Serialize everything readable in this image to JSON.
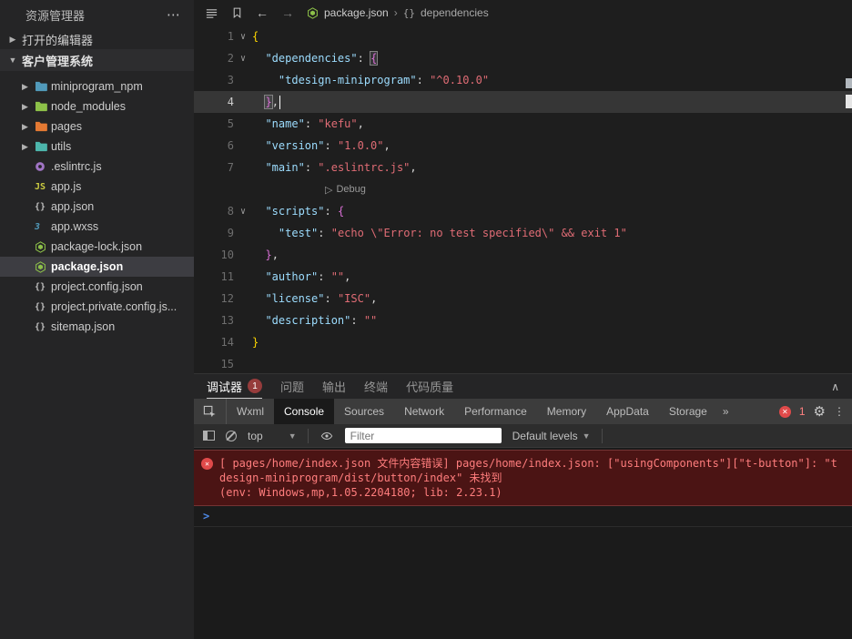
{
  "explorer": {
    "title": "资源管理器",
    "more": "⋯",
    "open_editors_label": "打开的编辑器",
    "project_label": "客户管理系统",
    "files": [
      {
        "name": "miniprogram_npm",
        "icon": "folder",
        "color": "#519aba"
      },
      {
        "name": "node_modules",
        "icon": "folder",
        "color": "#8dc149"
      },
      {
        "name": "pages",
        "icon": "folder",
        "color": "#e37933"
      },
      {
        "name": "utils",
        "icon": "folder",
        "color": "#4db6ac"
      },
      {
        "name": ".eslintrc.js",
        "icon": "eslint",
        "color": "#a074c4"
      },
      {
        "name": "app.js",
        "icon": "js",
        "color": "#cbcb41"
      },
      {
        "name": "app.json",
        "icon": "json",
        "color": "#bdbdbd"
      },
      {
        "name": "app.wxss",
        "icon": "wxss",
        "color": "#519aba"
      },
      {
        "name": "package-lock.json",
        "icon": "npm",
        "color": "#8dc149"
      },
      {
        "name": "package.json",
        "icon": "npm",
        "color": "#8dc149",
        "selected": true
      },
      {
        "name": "project.config.json",
        "icon": "json",
        "color": "#bdbdbd"
      },
      {
        "name": "project.private.config.js...",
        "icon": "json",
        "color": "#bdbdbd"
      },
      {
        "name": "sitemap.json",
        "icon": "json",
        "color": "#bdbdbd"
      }
    ]
  },
  "topbar": {
    "breadcrumb_file": "package.json",
    "breadcrumb_separator": "›",
    "breadcrumb_symbol_icon": "{}",
    "breadcrumb_symbol": "dependencies"
  },
  "editor": {
    "lines": [
      {
        "num": "1",
        "fold": true,
        "segs": [
          [
            "b1",
            "{"
          ]
        ]
      },
      {
        "num": "2",
        "fold": true,
        "segs": [
          [
            "p",
            "  "
          ],
          [
            "k",
            "\"dependencies\""
          ],
          [
            "p",
            ": "
          ],
          [
            "b2x",
            "{"
          ]
        ]
      },
      {
        "num": "3",
        "segs": [
          [
            "p",
            "    "
          ],
          [
            "k",
            "\"tdesign-miniprogram\""
          ],
          [
            "p",
            ": "
          ],
          [
            "s",
            "\"^0.10.0\""
          ]
        ]
      },
      {
        "num": "4",
        "hl": true,
        "cursor": true,
        "segs": [
          [
            "p",
            "  "
          ],
          [
            "b2x",
            "}"
          ],
          [
            "p",
            ","
          ]
        ]
      },
      {
        "num": "5",
        "segs": [
          [
            "p",
            "  "
          ],
          [
            "k",
            "\"name\""
          ],
          [
            "p",
            ": "
          ],
          [
            "s",
            "\"kefu\""
          ],
          [
            "p",
            ","
          ]
        ]
      },
      {
        "num": "6",
        "segs": [
          [
            "p",
            "  "
          ],
          [
            "k",
            "\"version\""
          ],
          [
            "p",
            ": "
          ],
          [
            "s",
            "\"1.0.0\""
          ],
          [
            "p",
            ","
          ]
        ]
      },
      {
        "num": "7",
        "segs": [
          [
            "p",
            "  "
          ],
          [
            "k",
            "\"main\""
          ],
          [
            "p",
            ": "
          ],
          [
            "s",
            "\".eslintrc.js\""
          ],
          [
            "p",
            ","
          ]
        ]
      },
      {
        "num": "",
        "lens": "Debug"
      },
      {
        "num": "8",
        "fold": true,
        "segs": [
          [
            "p",
            "  "
          ],
          [
            "k",
            "\"scripts\""
          ],
          [
            "p",
            ": "
          ],
          [
            "b2",
            "{"
          ]
        ]
      },
      {
        "num": "9",
        "segs": [
          [
            "p",
            "    "
          ],
          [
            "k",
            "\"test\""
          ],
          [
            "p",
            ": "
          ],
          [
            "s",
            "\"echo \\\"Error: no test specified\\\" && exit 1\""
          ]
        ]
      },
      {
        "num": "10",
        "segs": [
          [
            "p",
            "  "
          ],
          [
            "b2",
            "}"
          ],
          [
            "p",
            ","
          ]
        ]
      },
      {
        "num": "11",
        "segs": [
          [
            "p",
            "  "
          ],
          [
            "k",
            "\"author\""
          ],
          [
            "p",
            ": "
          ],
          [
            "s",
            "\"\""
          ],
          [
            "p",
            ","
          ]
        ]
      },
      {
        "num": "12",
        "segs": [
          [
            "p",
            "  "
          ],
          [
            "k",
            "\"license\""
          ],
          [
            "p",
            ": "
          ],
          [
            "s",
            "\"ISC\""
          ],
          [
            "p",
            ","
          ]
        ]
      },
      {
        "num": "13",
        "segs": [
          [
            "p",
            "  "
          ],
          [
            "k",
            "\"description\""
          ],
          [
            "p",
            ": "
          ],
          [
            "s",
            "\"\""
          ]
        ]
      },
      {
        "num": "14",
        "segs": [
          [
            "b1",
            "}"
          ]
        ]
      },
      {
        "num": "15",
        "segs": []
      }
    ]
  },
  "panel": {
    "tabs": [
      {
        "label": "调试器",
        "badge": "1",
        "active": true
      },
      {
        "label": "问题"
      },
      {
        "label": "输出"
      },
      {
        "label": "终端"
      },
      {
        "label": "代码质量"
      }
    ]
  },
  "devtools": {
    "tabs": [
      {
        "label": "Wxml"
      },
      {
        "label": "Console",
        "active": true
      },
      {
        "label": "Sources"
      },
      {
        "label": "Network"
      },
      {
        "label": "Performance"
      },
      {
        "label": "Memory"
      },
      {
        "label": "AppData"
      },
      {
        "label": "Storage"
      }
    ],
    "overflow": "»",
    "error_count": "1"
  },
  "console": {
    "context": "top",
    "filter_placeholder": "Filter",
    "levels": "Default levels",
    "prompt": ">",
    "error": {
      "message": "[ pages/home/index.json 文件内容错误] pages/home/index.json: [\"usingComponents\"][\"t-button\"]: \"tdesign-miniprogram/dist/button/index\" 未找到",
      "env": "(env: Windows,mp,1.05.2204180; lib: 2.23.1)"
    }
  },
  "colors": {
    "editor_bg": "#1e1e1e",
    "sidebar_bg": "#252526",
    "json_key": "#9cdcfe",
    "json_string": "#e06c75",
    "brace_outer": "#ffd700",
    "brace_inner": "#da70d6",
    "error_text": "#ff7d7d",
    "error_bg": "#4b1414",
    "npm_green": "#8dc149"
  }
}
